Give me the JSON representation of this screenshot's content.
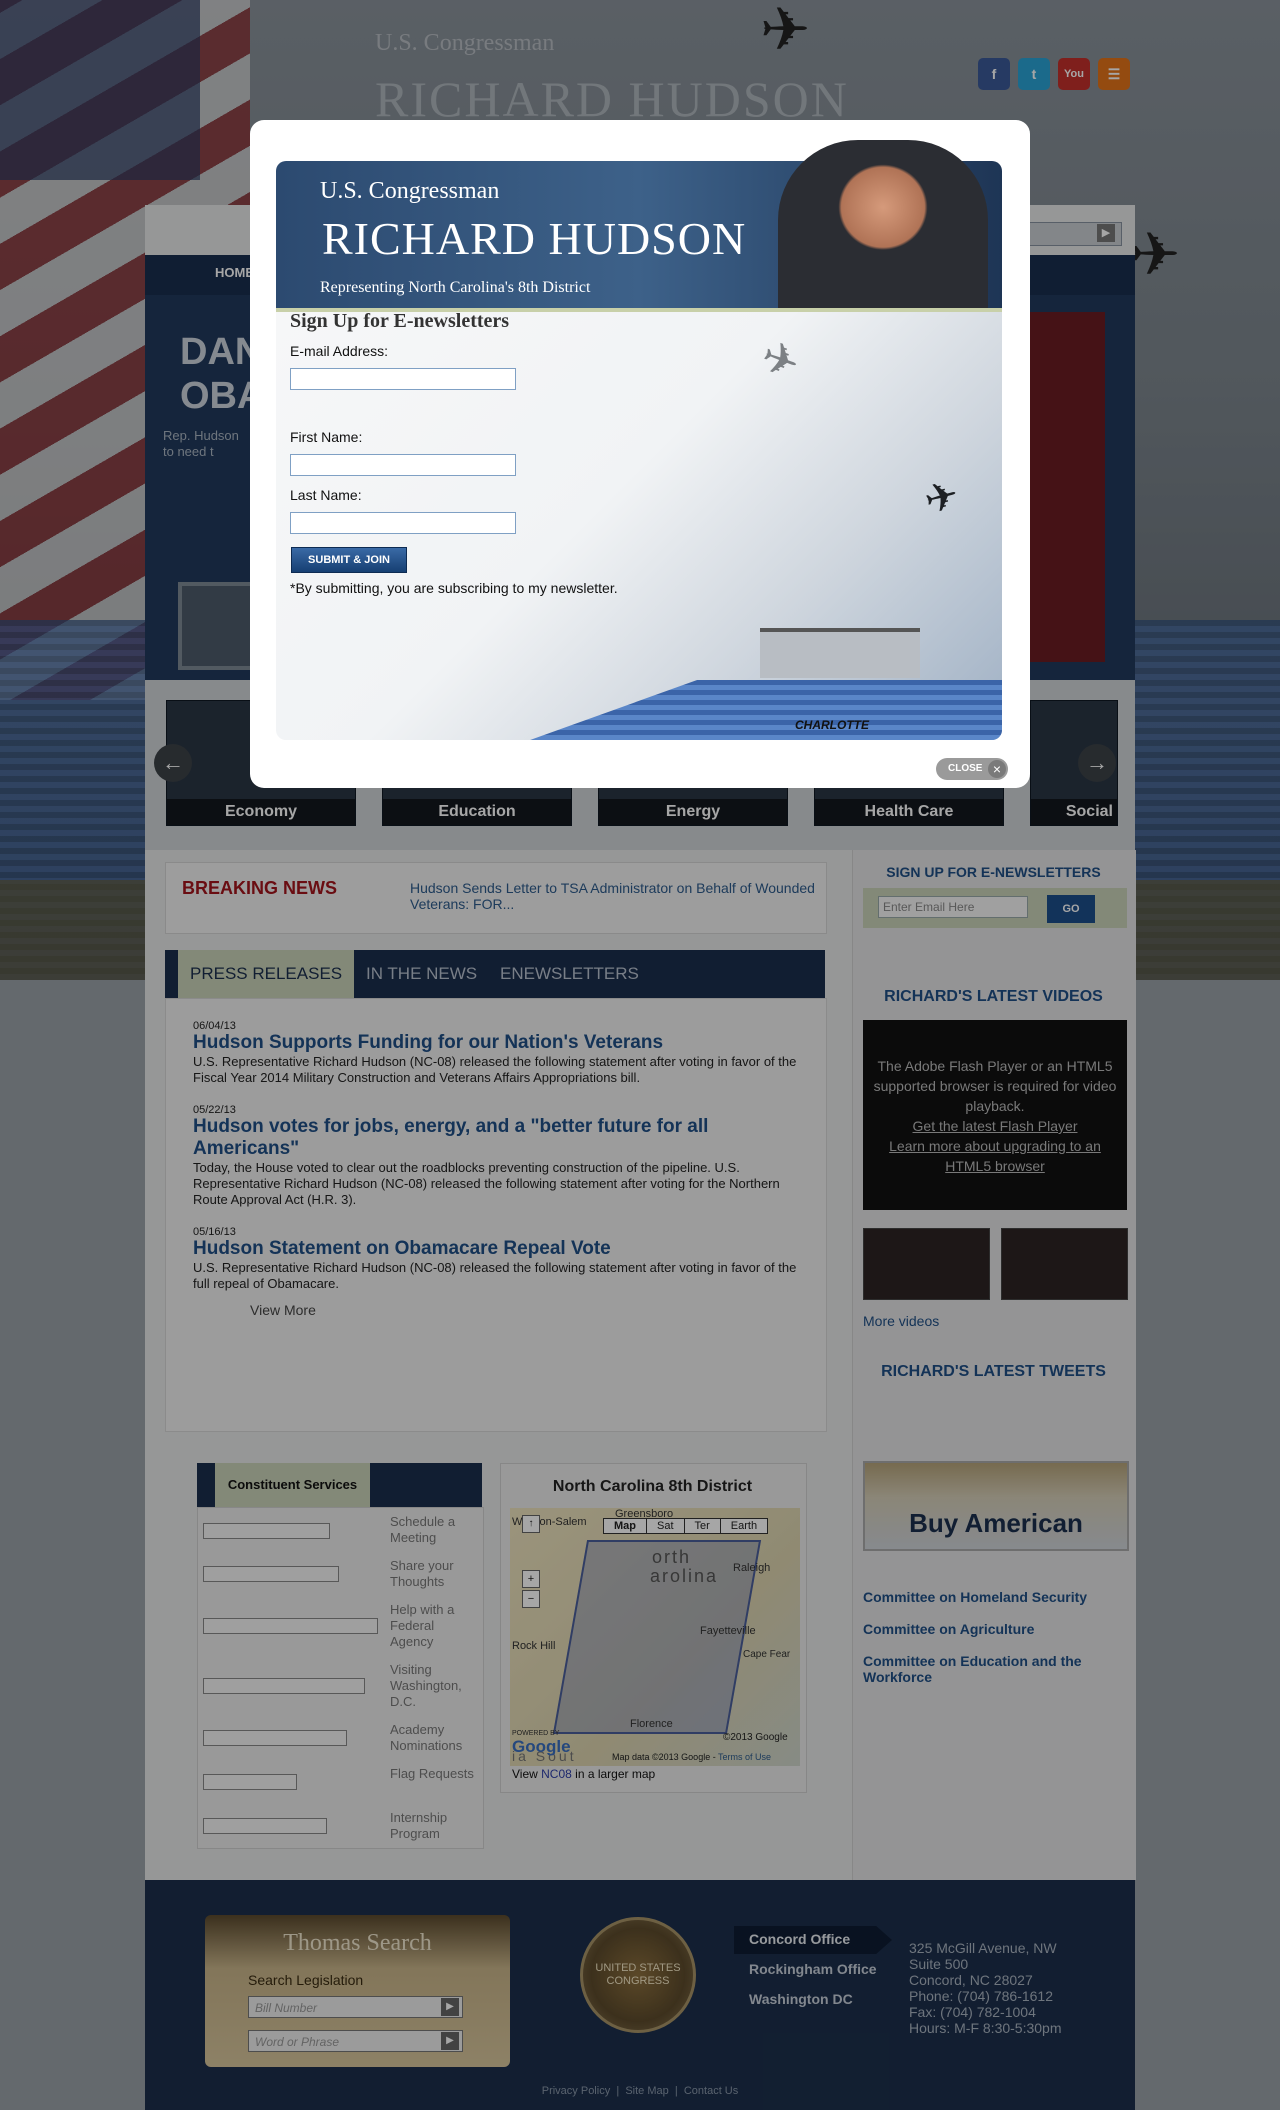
{
  "header": {
    "subtitle": "U.S. Congressman",
    "name": "RICHARD HUDSON"
  },
  "social": [
    {
      "icon": "facebook-icon",
      "glyph": "f",
      "color": "#3b5998"
    },
    {
      "icon": "twitter-icon",
      "glyph": "t",
      "color": "#2aa4d6"
    },
    {
      "icon": "youtube-icon",
      "glyph": "You",
      "color": "#c4302b"
    },
    {
      "icon": "rss-icon",
      "glyph": "☰",
      "color": "#e3731a"
    }
  ],
  "nav": {
    "home": "HOME"
  },
  "feature": {
    "title": "DAN OBA",
    "text": "Rep. Hudson to need t"
  },
  "categories": [
    "Economy",
    "Education",
    "Energy",
    "Health Care",
    "Social"
  ],
  "breaking": {
    "label": "BREAKING NEWS",
    "link": "Hudson Sends Letter to TSA Administrator on Behalf of Wounded Veterans: FOR..."
  },
  "tabs": [
    "PRESS RELEASES",
    "IN THE NEWS",
    "ENEWSLETTERS"
  ],
  "press_releases": [
    {
      "date": "06/04/13",
      "title": "Hudson Supports Funding for our Nation's Veterans",
      "text": "U.S. Representative Richard Hudson (NC-08) released the following statement after voting in favor of the Fiscal Year 2014 Military Construction and Veterans Affairs Appropriations bill."
    },
    {
      "date": "05/22/13",
      "title": "Hudson votes for jobs, energy, and a \"better future for all Americans\"",
      "text": "Today, the House voted to clear out the roadblocks preventing construction of the pipeline. U.S. Representative Richard Hudson (NC-08) released the following statement after voting for the Northern Route Approval Act (H.R. 3)."
    },
    {
      "date": "05/16/13",
      "title": "Hudson Statement on Obamacare Repeal Vote",
      "text": "U.S. Representative Richard Hudson (NC-08) released the following statement after voting in favor of the full repeal of Obamacare."
    }
  ],
  "view_more": "View More",
  "newsletter_side": {
    "heading": "SIGN UP FOR E-NEWSLETTERS",
    "placeholder": "Enter Email Here",
    "go": "GO"
  },
  "videos": {
    "heading": "RICHARD'S LATEST VIDEOS",
    "player_msg": "The Adobe Flash Player or an HTML5 supported browser is required for video playback.",
    "flash_link": "Get the latest Flash Player",
    "html5_link": "Learn more about upgrading to an HTML5 browser",
    "more": "More videos"
  },
  "tweets": {
    "heading": "RICHARD'S LATEST TWEETS"
  },
  "constituent": {
    "tab": "Constituent Services",
    "links": [
      "Schedule a Meeting",
      "Share your Thoughts",
      "Help with a Federal Agency",
      "Visiting Washington, D.C.",
      "Academy Nominations",
      "Flag Requests",
      "Internship Program"
    ]
  },
  "map": {
    "title": "North Carolina 8th District",
    "buttons": [
      "Map",
      "Sat",
      "Ter",
      "Earth"
    ],
    "labels": {
      "winston": "Winston-Salem",
      "greensboro": "Greensboro",
      "north": "orth",
      "carolina": "arolina",
      "raleigh": "Raleigh",
      "fayetteville": "Fayetteville",
      "capefear": "Cape Fear",
      "rockhill": "Rock Hill",
      "florence": "Florence",
      "south": "ia    Sout",
      "copyright": "©2013 Google",
      "mapdata": "Map data ©2013 Google - ",
      "terms": "Terms of Use",
      "powered": "POWERED BY",
      "google": "Google"
    },
    "view_prefix": "View ",
    "view_link": "NC08",
    "view_suffix": " in a larger map"
  },
  "buy_american": "Buy American",
  "committees": [
    "Committee on Homeland Security",
    "Committee on Agriculture",
    "Committee on Education and the Workforce"
  ],
  "footer": {
    "thomas_title": "Thomas Search",
    "thomas_sub": "Search Legislation",
    "bill_placeholder": "Bill Number",
    "phrase_placeholder": "Word or Phrase",
    "seal": "UNITED STATES CONGRESS",
    "offices": [
      "Concord Office",
      "Rockingham Office",
      "Washington DC"
    ],
    "address": [
      "325 McGill Avenue, NW",
      "Suite 500",
      "Concord, NC 28027",
      "Phone: (704) 786-1612",
      "Fax: (704) 782-1004",
      "Hours: M-F 8:30-5:30pm"
    ],
    "links": [
      "Privacy Policy",
      "Site Map",
      "Contact Us"
    ]
  },
  "modal": {
    "subtitle": "U.S. Congressman",
    "name": "RICHARD HUDSON",
    "tagline": "Representing North Carolina's 8th District",
    "heading": "Sign Up for E-newsletters",
    "email_label": "E-mail Address:",
    "first_label": "First Name:",
    "last_label": "Last Name:",
    "submit": "SUBMIT & JOIN",
    "note": "*By submitting, you are subscribing to my newsletter.",
    "stadium_sign": "CHARLOTTE",
    "close": "CLOSE"
  }
}
